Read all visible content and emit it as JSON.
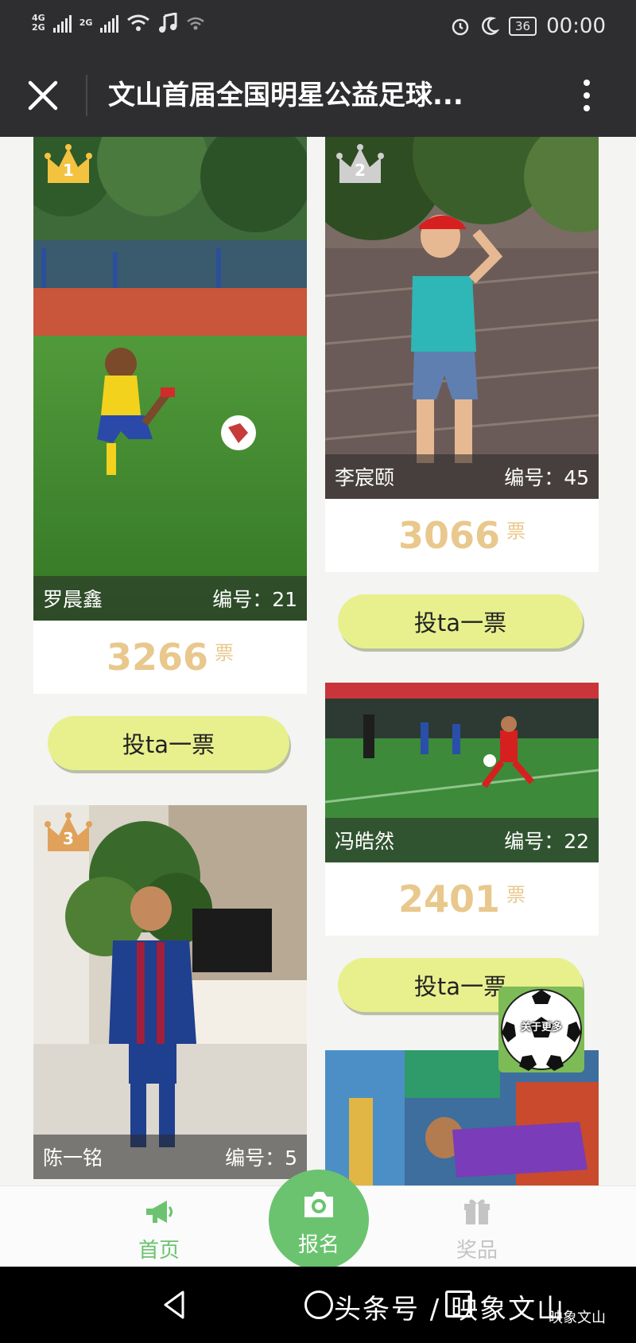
{
  "status_bar": {
    "network_top": "4G",
    "network_bottom": "2G",
    "network2": "2G",
    "battery": "36",
    "time": "00:00"
  },
  "header": {
    "title": "文山首届全国明星公益足球..."
  },
  "candidates": [
    {
      "rank": "1",
      "name": "罗晨鑫",
      "number_label": "编号：21",
      "votes": "3266",
      "vote_unit": "票",
      "vote_button": "投ta一票"
    },
    {
      "rank": "2",
      "name": "李宸颐",
      "number_label": "编号：45",
      "votes": "3066",
      "vote_unit": "票",
      "vote_button": "投ta一票"
    },
    {
      "rank": "3",
      "name": "陈一铭",
      "number_label": "编号：5"
    },
    {
      "name": "冯皓然",
      "number_label": "编号：22",
      "votes": "2401",
      "vote_unit": "票",
      "vote_button": "投ta一票"
    }
  ],
  "floating_button": {
    "label": "关于更多"
  },
  "tabs": [
    {
      "label": "首页",
      "icon": "megaphone-icon",
      "active": true
    },
    {
      "label": "报名",
      "icon": "camera-icon"
    },
    {
      "label": "奖品",
      "icon": "gift-icon"
    }
  ],
  "watermark": {
    "text": "头条号 / 映象文山",
    "logo_text": "映象文山"
  },
  "colors": {
    "accent_green": "#6bc36f",
    "vote_button": "#e8f08d",
    "vote_number": "#e9c88d",
    "gold_crown": "#f3c340",
    "silver_crown": "#cfcfcf",
    "bronze_crown": "#e0a25a"
  }
}
